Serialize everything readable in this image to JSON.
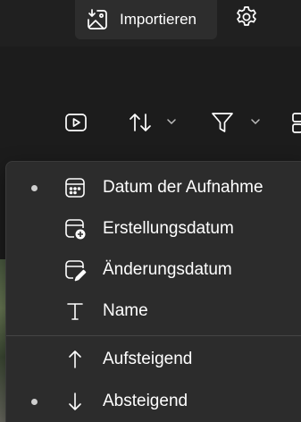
{
  "header": {
    "import_label": "Importieren",
    "import_icon": "import-photo-icon",
    "settings_icon": "gear-icon"
  },
  "toolbar": {
    "slideshow_icon": "play-icon",
    "sort_icon": "sort-arrows-icon",
    "filter_icon": "filter-funnel-icon"
  },
  "sort_menu": {
    "sort_by": [
      {
        "label": "Datum der Aufnahme",
        "icon": "calendar-icon",
        "selected": true
      },
      {
        "label": "Erstellungsdatum",
        "icon": "calendar-add-icon",
        "selected": false
      },
      {
        "label": "Änderungsdatum",
        "icon": "calendar-edit-icon",
        "selected": false
      },
      {
        "label": "Name",
        "icon": "text-t-icon",
        "selected": false
      }
    ],
    "order": [
      {
        "label": "Aufsteigend",
        "icon": "arrow-up-icon",
        "selected": false
      },
      {
        "label": "Absteigend",
        "icon": "arrow-down-icon",
        "selected": true
      }
    ]
  },
  "colors": {
    "background": "#1c1c1c",
    "menu_background": "#2c2c2c",
    "text": "#ffffff"
  }
}
